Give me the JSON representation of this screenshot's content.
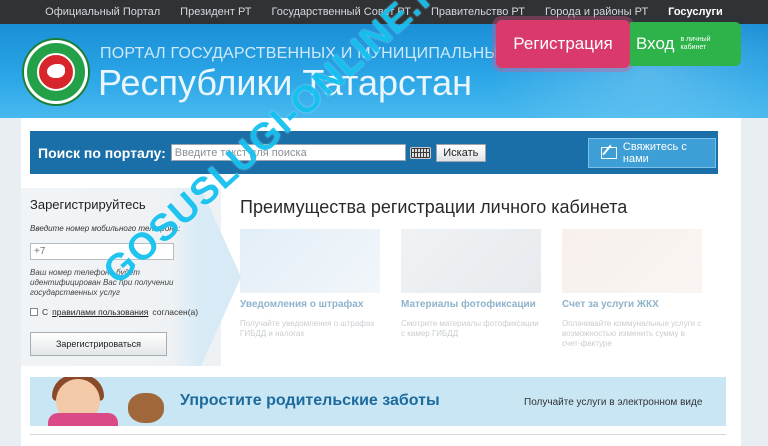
{
  "topnav": {
    "items": [
      "Официальный Портал",
      "Президент РТ",
      "Государственный Совет РТ",
      "Правительство РТ",
      "Города и районы РТ",
      "Госуслуги"
    ]
  },
  "header": {
    "subtitle": "ПОРТАЛ ГОСУДАРСТВЕННЫХ И МУНИЦИПАЛЬНЫХ УСЛУГ",
    "title": "Республики Татарстан",
    "register_label": "Регистрация",
    "login_label": "Вход",
    "login_sublabel": "в личный кабинет"
  },
  "search": {
    "label": "Поиск по порталу:",
    "placeholder": "Введите текст для поиска",
    "button": "Искать",
    "contact_button": "Свяжитесь с нами"
  },
  "registration": {
    "title": "Зарегистрируйтесь",
    "phone_label": "Введите номер мобильного телефона:",
    "phone_placeholder": "+7",
    "note": "Ваш номер телефона будет идентифицирован Вас при получении государственных услуг",
    "agree_prefix": "С",
    "agree_link": "правилами пользования",
    "agree_suffix": "согласен(а)",
    "submit": "Зарегистрироваться"
  },
  "advantages": {
    "title": "Преимущества регистрации личного кабинета",
    "cards": [
      {
        "title": "Уведомления о штрафах",
        "text": "Получайте уведомления о штрафах ГИБДД и налогах"
      },
      {
        "title": "Материалы фотофиксации",
        "text": "Смотрите материалы фотофиксации с камер ГИБДД"
      },
      {
        "title": "Счет за услуги ЖКХ",
        "text": "Оплачивайте коммунальные услуги с возможностью изменить сумму в счет-фактуре"
      }
    ]
  },
  "banner": {
    "main": "Упростите родительские заботы",
    "sub": "Получайте услуги в электронном виде"
  },
  "watermark": "GOSUSLUGI-ONLINE.RU",
  "colors": {
    "header_blue": "#1b8fd6",
    "register_pink": "#d93a6b",
    "login_green": "#2db34a",
    "search_bar": "#1a6fa8",
    "watermark": "#16c1ef"
  }
}
